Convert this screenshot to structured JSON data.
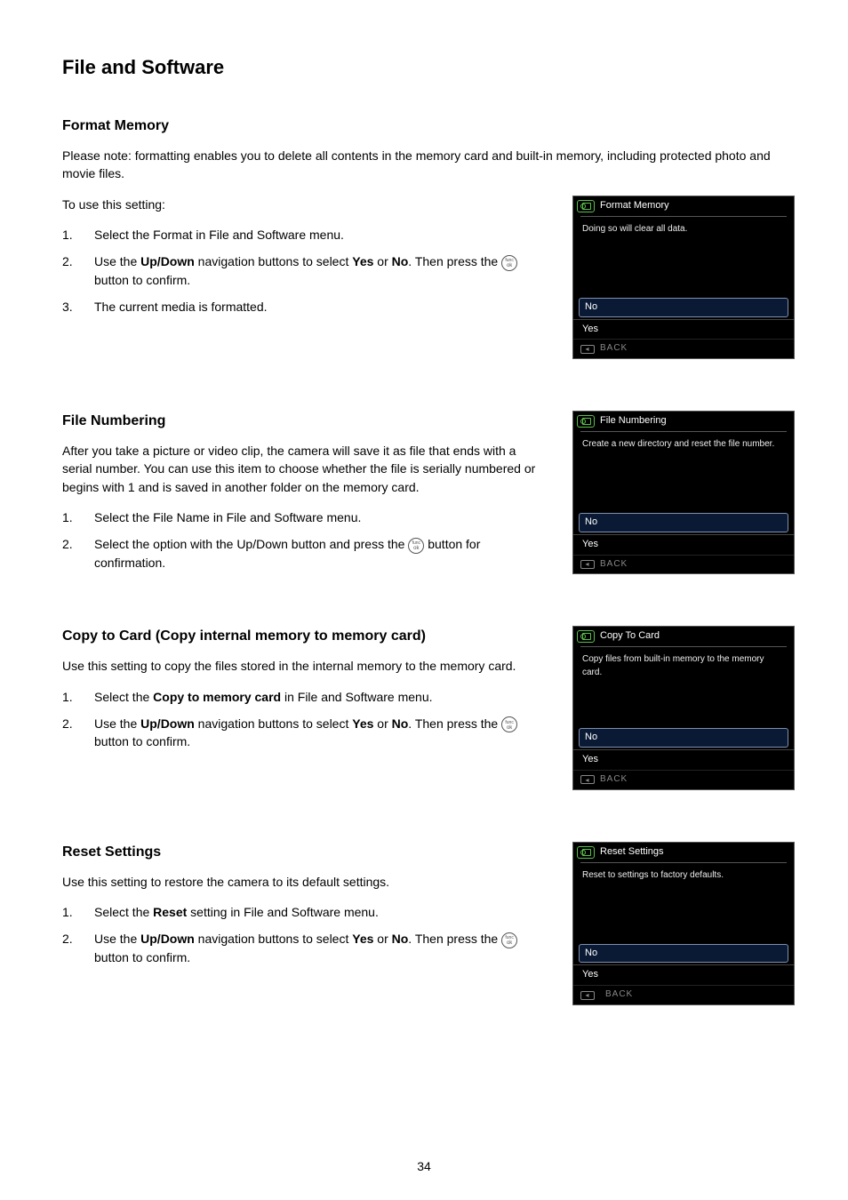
{
  "page": {
    "title": "File and Software",
    "number": "34"
  },
  "funcOk": {
    "top": "func",
    "bottom": "ok"
  },
  "sections": {
    "format": {
      "title": "Format Memory",
      "intro": "Please note: formatting enables you to delete all contents in the memory card and built-in memory, including protected photo and movie files.",
      "lead": "To use this setting:",
      "steps": {
        "s1": "Select the Format in File and Software menu.",
        "s2a": "Use the ",
        "s2b": "Up/Down",
        "s2c": " navigation buttons to select ",
        "s2d": "Yes",
        "s2e": " or ",
        "s2f": "No",
        "s2g": ". Then press the ",
        "s2h": " button to confirm.",
        "s3": "The current media is formatted."
      },
      "panel": {
        "title": "Format Memory",
        "desc": "Doing so will clear all data.",
        "optNo": "No",
        "optYes": "Yes",
        "back": "BACK"
      }
    },
    "fileNumbering": {
      "title": "File Numbering",
      "intro": "After you take a picture or video clip, the camera will save it as file that ends with a serial number. You can use this item to choose whether the file is serially numbered or begins with 1 and is saved in another folder on the memory card.",
      "steps": {
        "s1": "Select the File Name in File and Software menu.",
        "s2a": "Select the option with the Up/Down button and press the ",
        "s2b": " button for confirmation."
      },
      "panel": {
        "title": "File Numbering",
        "desc": "Create a new directory and  reset the file number.",
        "optNo": "No",
        "optYes": "Yes",
        "back": "BACK"
      }
    },
    "copy": {
      "title": "Copy to Card (Copy internal memory to memory card)",
      "intro": "Use this setting to copy the files stored in the internal memory to the memory card.",
      "steps": {
        "s1a": "Select the ",
        "s1b": "Copy to memory card",
        "s1c": " in File and Software menu.",
        "s2a": "Use the ",
        "s2b": "Up/Down",
        "s2c": " navigation buttons to select ",
        "s2d": "Yes",
        "s2e": " or ",
        "s2f": "No",
        "s2g": ". Then press the ",
        "s2h": " button to confirm."
      },
      "panel": {
        "title": "Copy To Card",
        "desc": "Copy files from built-in memory to the memory card.",
        "optNo": "No",
        "optYes": "Yes",
        "back": "BACK"
      }
    },
    "reset": {
      "title": "Reset Settings",
      "intro": "Use this setting to restore the camera to its default settings.",
      "steps": {
        "s1a": "Select the ",
        "s1b": "Reset",
        "s1c": " setting in File and Software menu.",
        "s2a": "Use the ",
        "s2b": "Up/Down",
        "s2c": " navigation buttons to select ",
        "s2d": "Yes",
        "s2e": " or ",
        "s2f": "No",
        "s2g": ". Then press the ",
        "s2h": " button to confirm."
      },
      "panel": {
        "title": "Reset Settings",
        "desc": "Reset to settings to factory defaults.",
        "optNo": "No",
        "optYes": "Yes",
        "back": "BACK"
      }
    }
  }
}
